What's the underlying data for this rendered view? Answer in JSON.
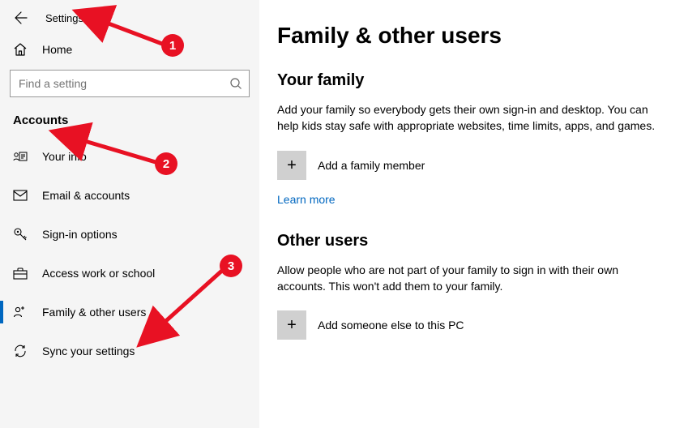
{
  "header": {
    "app_title": "Settings",
    "home_label": "Home"
  },
  "search": {
    "placeholder": "Find a setting"
  },
  "category": {
    "title": "Accounts"
  },
  "nav": {
    "items": [
      {
        "label": "Your info"
      },
      {
        "label": "Email & accounts"
      },
      {
        "label": "Sign-in options"
      },
      {
        "label": "Access work or school"
      },
      {
        "label": "Family & other users"
      },
      {
        "label": "Sync your settings"
      }
    ]
  },
  "main": {
    "page_title": "Family & other users",
    "family": {
      "section_title": "Your family",
      "desc": "Add your family so everybody gets their own sign-in and desktop. You can help kids stay safe with appropriate websites, time limits, apps, and games.",
      "add_label": "Add a family member",
      "learn_more": "Learn more"
    },
    "other": {
      "section_title": "Other users",
      "desc": "Allow people who are not part of your family to sign in with their own accounts. This won't add them to your family.",
      "add_label": "Add someone else to this PC"
    }
  },
  "annotations": {
    "b1": "1",
    "b2": "2",
    "b3": "3"
  }
}
